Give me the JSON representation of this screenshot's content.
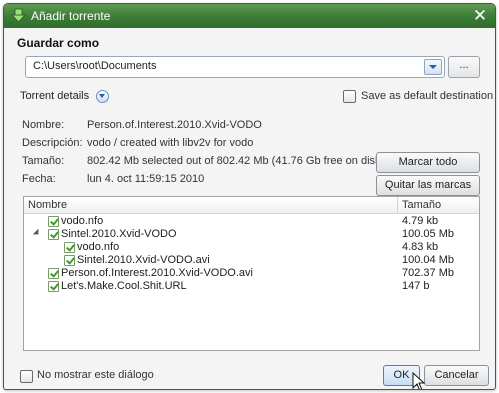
{
  "window": {
    "title": "Añadir torrente"
  },
  "save_as": {
    "section_title": "Guardar como",
    "path": "C:\\Users\\root\\Documents",
    "browse_label": "..."
  },
  "details": {
    "toggle_label": "Torrent details",
    "save_default_label": "Save as default destination",
    "save_default_checked": false
  },
  "info": {
    "name_label": "Nombre:",
    "name_value": "Person.of.Interest.2010.Xvid-VODO",
    "desc_label": "Descripción:",
    "desc_value": "vodo / created with libv2v for vodo",
    "size_label": "Tamaño:",
    "size_value": "802.42 Mb selected out of 802.42 Mb (41.76 Gb free on disk)",
    "date_label": "Fecha:",
    "date_value": "lun 4. oct 11:59:15 2010"
  },
  "actions": {
    "mark_all": "Marcar todo",
    "unmark_all": "Quitar las marcas"
  },
  "files": {
    "col_name": "Nombre",
    "col_size": "Tamaño",
    "rows": [
      {
        "name": "vodo.nfo",
        "size": "4.79 kb",
        "checked": true
      },
      {
        "name": "Sintel.2010.Xvid-VODO",
        "size": "100.05 Mb",
        "checked": true,
        "expanded": true
      },
      {
        "name": "vodo.nfo",
        "size": "4.83 kb",
        "checked": true
      },
      {
        "name": "Sintel.2010.Xvid-VODO.avi",
        "size": "100.04 Mb",
        "checked": true
      },
      {
        "name": "Person.of.Interest.2010.Xvid-VODO.avi",
        "size": "702.37 Mb",
        "checked": true
      },
      {
        "name": "Let's.Make.Cool.Shit.URL",
        "size": "147 b",
        "checked": true
      }
    ]
  },
  "footer": {
    "no_show_label": "No mostrar este diálogo",
    "no_show_checked": false,
    "ok_label": "OK",
    "cancel_label": "Cancelar"
  },
  "colors": {
    "titlebar": "#3d7c37",
    "check_green": "#3d9a2b",
    "default_button_border": "#4a7fc1"
  }
}
